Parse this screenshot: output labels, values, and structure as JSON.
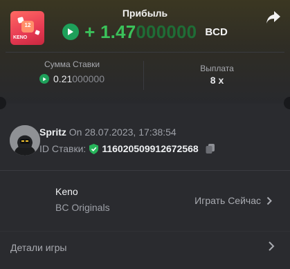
{
  "header": {
    "profit_label": "Прибыль",
    "profit_sign_and_bright": "+ 1.47",
    "profit_dim": "000000",
    "currency": "BCD",
    "share_icon": "share-icon"
  },
  "stats": {
    "bet_amount_label": "Сумма Ставки",
    "bet_amount_bright": "0.21",
    "bet_amount_dim": "000000",
    "payout_label": "Выплата",
    "payout_value": "8 x"
  },
  "user": {
    "name": "Spritz",
    "on_date": "On 28.07.2023, 17:38:54",
    "bet_id_label": "ID Ставки:",
    "bet_id": "116020509912672568"
  },
  "game": {
    "title": "Keno",
    "subtitle": "BC Originals",
    "play_now": "Играть Сейчас",
    "thumb_badge": "12",
    "thumb_text": "KENO"
  },
  "details": {
    "label": "Детали игры"
  },
  "colors": {
    "accent_green": "#3bc25a",
    "background": "#2a2b2f"
  }
}
